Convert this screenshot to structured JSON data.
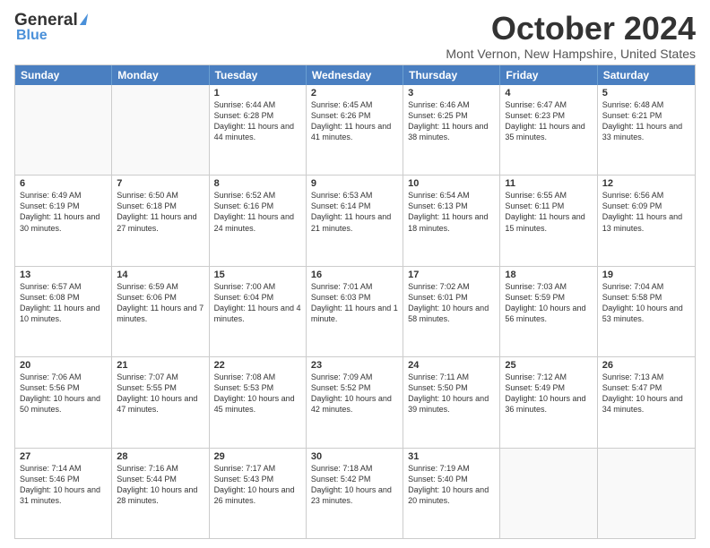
{
  "logo": {
    "general": "General",
    "blue": "Blue"
  },
  "title": "October 2024",
  "location": "Mont Vernon, New Hampshire, United States",
  "days": [
    "Sunday",
    "Monday",
    "Tuesday",
    "Wednesday",
    "Thursday",
    "Friday",
    "Saturday"
  ],
  "weeks": [
    [
      {
        "day": "",
        "text": ""
      },
      {
        "day": "",
        "text": ""
      },
      {
        "day": "1",
        "text": "Sunrise: 6:44 AM\nSunset: 6:28 PM\nDaylight: 11 hours and 44 minutes."
      },
      {
        "day": "2",
        "text": "Sunrise: 6:45 AM\nSunset: 6:26 PM\nDaylight: 11 hours and 41 minutes."
      },
      {
        "day": "3",
        "text": "Sunrise: 6:46 AM\nSunset: 6:25 PM\nDaylight: 11 hours and 38 minutes."
      },
      {
        "day": "4",
        "text": "Sunrise: 6:47 AM\nSunset: 6:23 PM\nDaylight: 11 hours and 35 minutes."
      },
      {
        "day": "5",
        "text": "Sunrise: 6:48 AM\nSunset: 6:21 PM\nDaylight: 11 hours and 33 minutes."
      }
    ],
    [
      {
        "day": "6",
        "text": "Sunrise: 6:49 AM\nSunset: 6:19 PM\nDaylight: 11 hours and 30 minutes."
      },
      {
        "day": "7",
        "text": "Sunrise: 6:50 AM\nSunset: 6:18 PM\nDaylight: 11 hours and 27 minutes."
      },
      {
        "day": "8",
        "text": "Sunrise: 6:52 AM\nSunset: 6:16 PM\nDaylight: 11 hours and 24 minutes."
      },
      {
        "day": "9",
        "text": "Sunrise: 6:53 AM\nSunset: 6:14 PM\nDaylight: 11 hours and 21 minutes."
      },
      {
        "day": "10",
        "text": "Sunrise: 6:54 AM\nSunset: 6:13 PM\nDaylight: 11 hours and 18 minutes."
      },
      {
        "day": "11",
        "text": "Sunrise: 6:55 AM\nSunset: 6:11 PM\nDaylight: 11 hours and 15 minutes."
      },
      {
        "day": "12",
        "text": "Sunrise: 6:56 AM\nSunset: 6:09 PM\nDaylight: 11 hours and 13 minutes."
      }
    ],
    [
      {
        "day": "13",
        "text": "Sunrise: 6:57 AM\nSunset: 6:08 PM\nDaylight: 11 hours and 10 minutes."
      },
      {
        "day": "14",
        "text": "Sunrise: 6:59 AM\nSunset: 6:06 PM\nDaylight: 11 hours and 7 minutes."
      },
      {
        "day": "15",
        "text": "Sunrise: 7:00 AM\nSunset: 6:04 PM\nDaylight: 11 hours and 4 minutes."
      },
      {
        "day": "16",
        "text": "Sunrise: 7:01 AM\nSunset: 6:03 PM\nDaylight: 11 hours and 1 minute."
      },
      {
        "day": "17",
        "text": "Sunrise: 7:02 AM\nSunset: 6:01 PM\nDaylight: 10 hours and 58 minutes."
      },
      {
        "day": "18",
        "text": "Sunrise: 7:03 AM\nSunset: 5:59 PM\nDaylight: 10 hours and 56 minutes."
      },
      {
        "day": "19",
        "text": "Sunrise: 7:04 AM\nSunset: 5:58 PM\nDaylight: 10 hours and 53 minutes."
      }
    ],
    [
      {
        "day": "20",
        "text": "Sunrise: 7:06 AM\nSunset: 5:56 PM\nDaylight: 10 hours and 50 minutes."
      },
      {
        "day": "21",
        "text": "Sunrise: 7:07 AM\nSunset: 5:55 PM\nDaylight: 10 hours and 47 minutes."
      },
      {
        "day": "22",
        "text": "Sunrise: 7:08 AM\nSunset: 5:53 PM\nDaylight: 10 hours and 45 minutes."
      },
      {
        "day": "23",
        "text": "Sunrise: 7:09 AM\nSunset: 5:52 PM\nDaylight: 10 hours and 42 minutes."
      },
      {
        "day": "24",
        "text": "Sunrise: 7:11 AM\nSunset: 5:50 PM\nDaylight: 10 hours and 39 minutes."
      },
      {
        "day": "25",
        "text": "Sunrise: 7:12 AM\nSunset: 5:49 PM\nDaylight: 10 hours and 36 minutes."
      },
      {
        "day": "26",
        "text": "Sunrise: 7:13 AM\nSunset: 5:47 PM\nDaylight: 10 hours and 34 minutes."
      }
    ],
    [
      {
        "day": "27",
        "text": "Sunrise: 7:14 AM\nSunset: 5:46 PM\nDaylight: 10 hours and 31 minutes."
      },
      {
        "day": "28",
        "text": "Sunrise: 7:16 AM\nSunset: 5:44 PM\nDaylight: 10 hours and 28 minutes."
      },
      {
        "day": "29",
        "text": "Sunrise: 7:17 AM\nSunset: 5:43 PM\nDaylight: 10 hours and 26 minutes."
      },
      {
        "day": "30",
        "text": "Sunrise: 7:18 AM\nSunset: 5:42 PM\nDaylight: 10 hours and 23 minutes."
      },
      {
        "day": "31",
        "text": "Sunrise: 7:19 AM\nSunset: 5:40 PM\nDaylight: 10 hours and 20 minutes."
      },
      {
        "day": "",
        "text": ""
      },
      {
        "day": "",
        "text": ""
      }
    ]
  ]
}
